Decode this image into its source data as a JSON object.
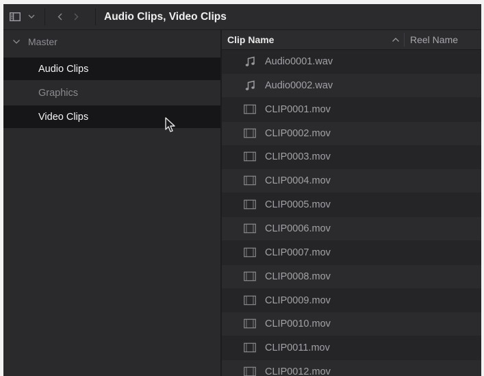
{
  "window": {
    "title": "Audio Clips, Video Clips"
  },
  "toolbar": {
    "icons": [
      "panel-toggle-icon",
      "chevron-down-icon",
      "back-arrow-icon",
      "forward-arrow-icon"
    ]
  },
  "sidebar": {
    "master_label": "Master",
    "bins": [
      {
        "label": "Audio Clips",
        "selected": true
      },
      {
        "label": "Graphics",
        "selected": false
      },
      {
        "label": "Video Clips",
        "selected": true
      }
    ]
  },
  "clip_list": {
    "columns": {
      "clip_name": "Clip Name",
      "reel_name": "Reel Name"
    },
    "sort": "ascending",
    "clips": [
      {
        "name": "Audio0001.wav",
        "type": "audio",
        "icon": "music-note-icon"
      },
      {
        "name": "Audio0002.wav",
        "type": "audio",
        "icon": "music-note-icon"
      },
      {
        "name": "CLIP0001.mov",
        "type": "video",
        "icon": "film-strip-icon"
      },
      {
        "name": "CLIP0002.mov",
        "type": "video",
        "icon": "film-strip-icon"
      },
      {
        "name": "CLIP0003.mov",
        "type": "video",
        "icon": "film-strip-icon"
      },
      {
        "name": "CLIP0004.mov",
        "type": "video",
        "icon": "film-strip-icon"
      },
      {
        "name": "CLIP0005.mov",
        "type": "video",
        "icon": "film-strip-icon"
      },
      {
        "name": "CLIP0006.mov",
        "type": "video",
        "icon": "film-strip-icon"
      },
      {
        "name": "CLIP0007.mov",
        "type": "video",
        "icon": "film-strip-icon"
      },
      {
        "name": "CLIP0008.mov",
        "type": "video",
        "icon": "film-strip-icon"
      },
      {
        "name": "CLIP0009.mov",
        "type": "video",
        "icon": "film-strip-icon"
      },
      {
        "name": "CLIP0010.mov",
        "type": "video",
        "icon": "film-strip-icon"
      },
      {
        "name": "CLIP0011.mov",
        "type": "video",
        "icon": "film-strip-icon"
      },
      {
        "name": "CLIP0012.mov",
        "type": "video",
        "icon": "film-strip-icon"
      }
    ]
  },
  "colors": {
    "background": "#28282b",
    "selected_bin": "#161618",
    "text_primary": "#f0f0f0",
    "text_muted": "#8b8b8f"
  }
}
